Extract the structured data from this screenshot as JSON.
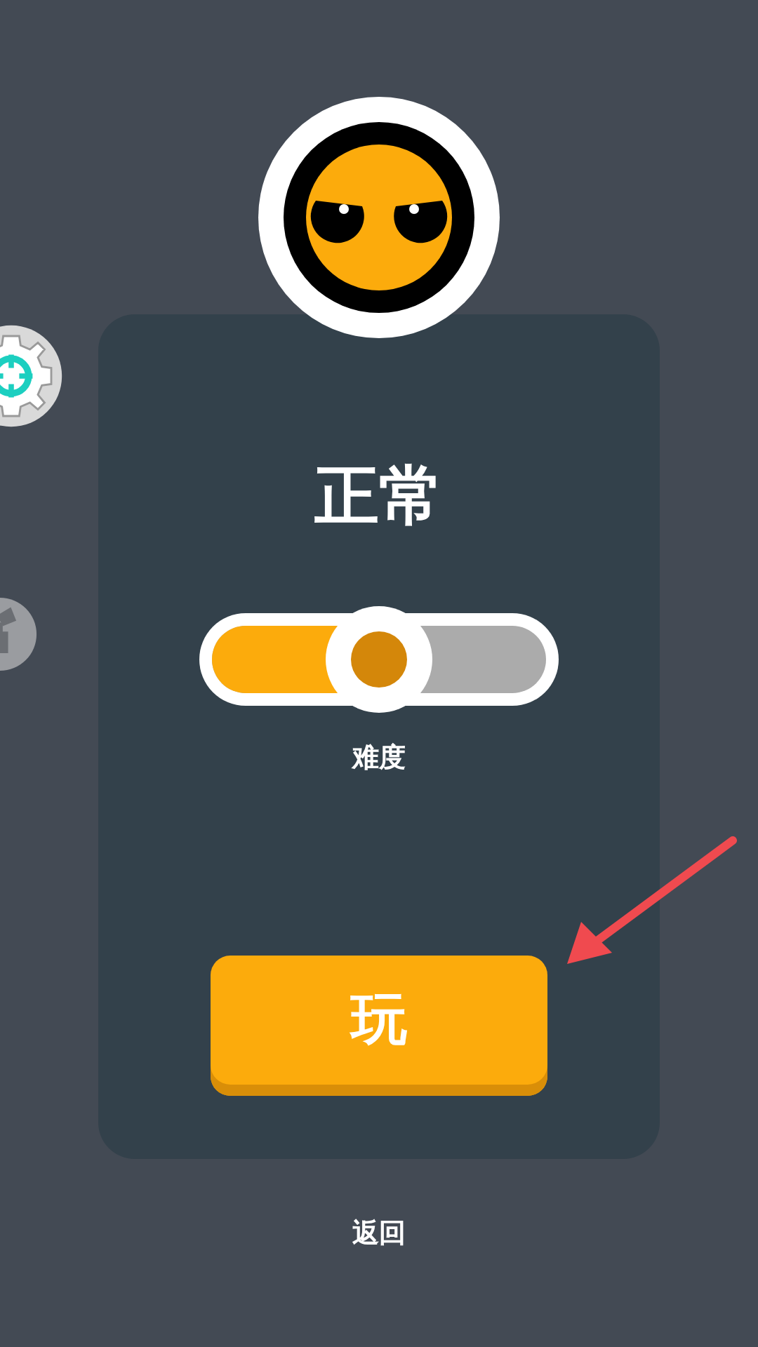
{
  "title": "正常",
  "difficulty_slider": {
    "level": 0.5,
    "label": "难度"
  },
  "play_button": {
    "label": "玩"
  },
  "back_link": {
    "label": "返回"
  }
}
